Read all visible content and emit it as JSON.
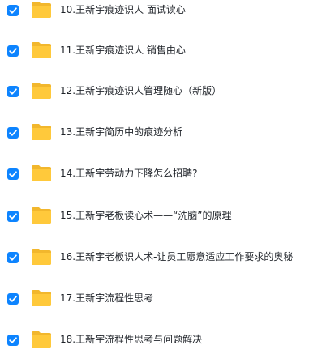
{
  "list": {
    "items": [
      {
        "name": "10.王新宇痕迹识人 面试读心",
        "checked": true
      },
      {
        "name": "11.王新宇痕迹识人 销售由心",
        "checked": true
      },
      {
        "name": "12.王新宇痕迹识人管理随心（新版）",
        "checked": true
      },
      {
        "name": "13.王新宇简历中的痕迹分析",
        "checked": true
      },
      {
        "name": "14.王新宇劳动力下降怎么招聘?",
        "checked": true
      },
      {
        "name": "15.王新宇老板读心术——“洗脑”的原理",
        "checked": true
      },
      {
        "name": "16.王新宇老板识人术-让员工愿意适应工作要求的奥秘",
        "checked": true
      },
      {
        "name": "17.王新宇流程性思考",
        "checked": true
      },
      {
        "name": "18.王新宇流程性思考与问题解决",
        "checked": true
      }
    ]
  },
  "icons": {
    "checkbox": "checkbox-checked-icon",
    "folder": "folder-icon"
  },
  "colors": {
    "checkbox": "#0d84ff",
    "folder_body": "#ffc93b",
    "folder_tab": "#f2b72d",
    "text": "#1f2329"
  }
}
